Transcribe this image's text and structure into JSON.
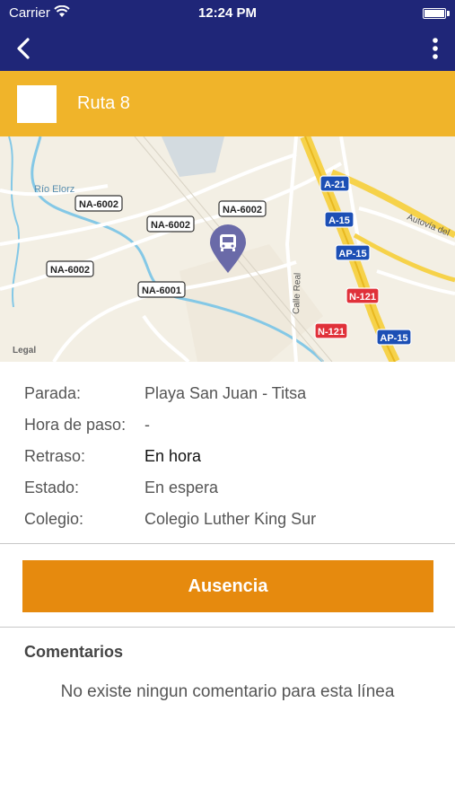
{
  "status_bar": {
    "carrier": "Carrier",
    "time": "12:24 PM"
  },
  "nav": {
    "back_icon": "chevron-left-icon",
    "more_icon": "more-vertical-icon"
  },
  "route": {
    "name": "Ruta 8",
    "color": "#f0b42a"
  },
  "map": {
    "labels": {
      "river": "Río Elorz",
      "legal": "Legal",
      "calle_real": "Calle Real",
      "autovia": "Autovía del",
      "na6002": "NA-6002",
      "na6001": "NA-6001",
      "a21": "A-21",
      "a15": "A-15",
      "ap15": "AP-15",
      "n121": "N-121"
    },
    "marker_icon": "bus-icon"
  },
  "details": [
    {
      "label": "Parada:",
      "value": "Playa San Juan - Titsa"
    },
    {
      "label": "Hora de paso:",
      "value": "-"
    },
    {
      "label": "Retraso:",
      "value": "En hora"
    },
    {
      "label": "Estado:",
      "value": "En espera"
    },
    {
      "label": "Colegio:",
      "value": "Colegio Luther King Sur"
    }
  ],
  "action_button": {
    "label": "Ausencia",
    "color": "#e68a0e"
  },
  "comments": {
    "title": "Comentarios",
    "empty_text": "No existe ningun comentario para esta línea"
  },
  "colors": {
    "nav_bg": "#1f2678",
    "route_bg": "#f0b42a",
    "button_bg": "#e68a0e"
  }
}
